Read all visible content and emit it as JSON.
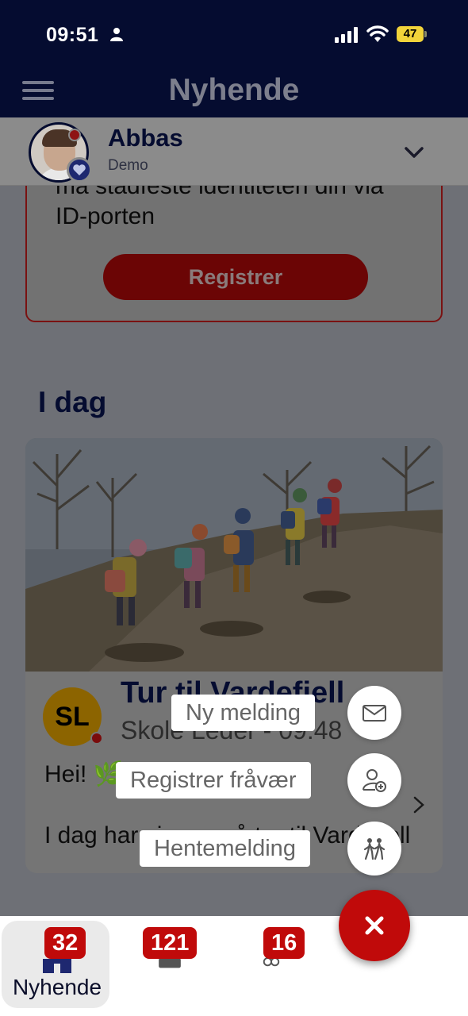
{
  "status_bar": {
    "time": "09:51",
    "battery": "47"
  },
  "header": {
    "title": "Nyhende"
  },
  "profile": {
    "name": "Abbas",
    "subtitle": "Demo"
  },
  "id_notice": {
    "text_line1": "må stadfeste identiteten din via",
    "text_line2": "ID-porten",
    "button_label": "Registrer"
  },
  "today": {
    "section_title": "I dag",
    "post": {
      "avatar_initials": "SL",
      "title": "Tur til Vardefjell",
      "meta": "Skole Leder - 09:48",
      "line1": "Hei! 🌿",
      "line2": "I dag har vi vore på tur til Vardefjell"
    }
  },
  "speed_dial": {
    "items": [
      {
        "label": "Ny melding",
        "icon": "envelope-icon"
      },
      {
        "label": "Registrer fråvær",
        "icon": "person-add-icon"
      },
      {
        "label": "Hentemelding",
        "icon": "pickup-icon"
      }
    ],
    "close_icon": "close-icon"
  },
  "tab_bar": {
    "tabs": [
      {
        "label": "Nyhende",
        "badge": "32",
        "icon": "home-icon",
        "active": true
      },
      {
        "label": "",
        "badge": "121",
        "icon": "messages-icon",
        "active": false
      },
      {
        "label": "",
        "badge": "16",
        "icon": "people-icon",
        "active": false
      }
    ]
  },
  "colors": {
    "navy": "#050c30",
    "accent_red": "#c00a0a",
    "battery_yellow": "#f2d43a"
  }
}
